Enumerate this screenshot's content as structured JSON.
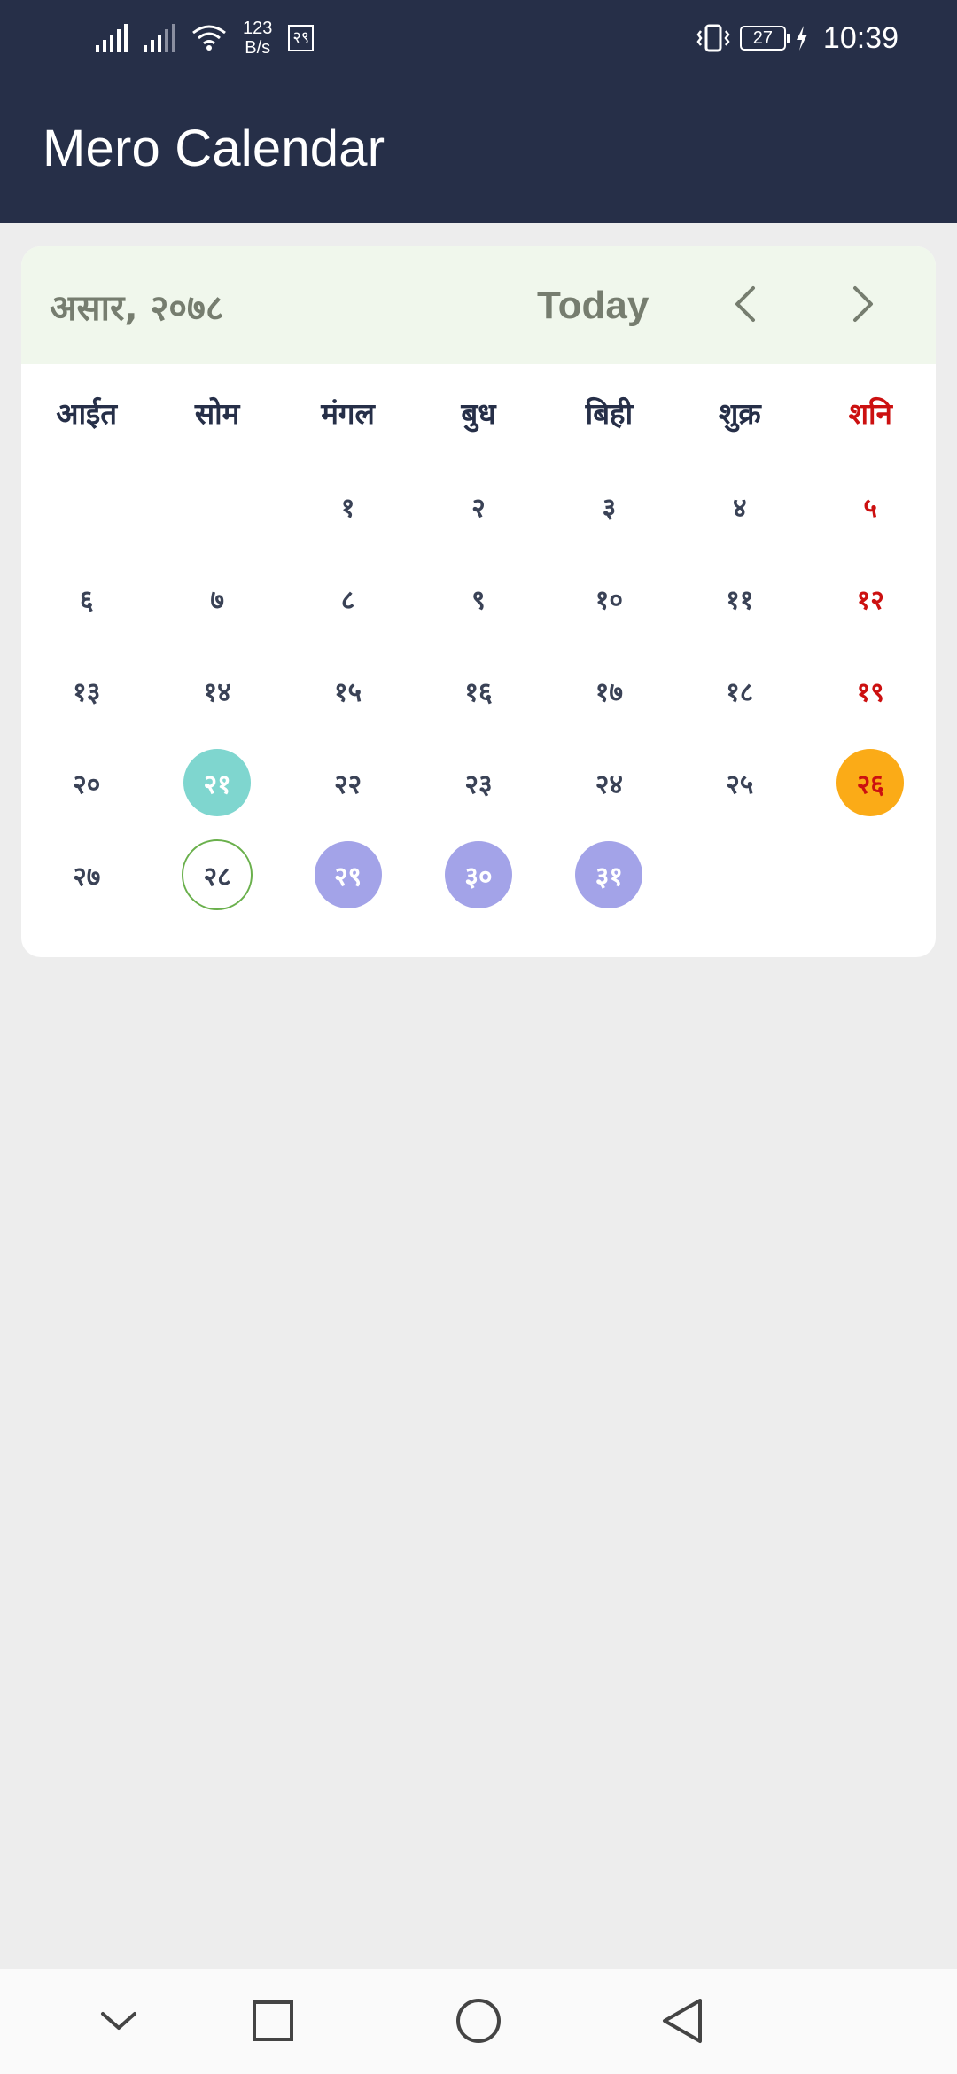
{
  "status_bar": {
    "net_speed_value": "123",
    "net_speed_unit": "B/s",
    "notification_badge": "२९",
    "battery": "27",
    "time": "10:39"
  },
  "app_bar": {
    "title": "Mero Calendar"
  },
  "calendar": {
    "month_label": "असार, २०७८",
    "today_label": "Today",
    "weekdays": [
      "आईत",
      "सोम",
      "मंगल",
      "बुध",
      "बिही",
      "शुक्र",
      "शनि"
    ],
    "weeks": [
      [
        "",
        "",
        "१",
        "२",
        "३",
        "४",
        "५"
      ],
      [
        "६",
        "७",
        "८",
        "९",
        "१०",
        "११",
        "१२"
      ],
      [
        "१३",
        "१४",
        "१५",
        "१६",
        "१७",
        "१८",
        "१९"
      ],
      [
        "२०",
        "२१",
        "२२",
        "२३",
        "२४",
        "२५",
        "२६"
      ],
      [
        "२७",
        "२८",
        "२९",
        "३०",
        "३१",
        "",
        ""
      ]
    ]
  },
  "colors": {
    "header": "#262f48",
    "card_header": "#f0f7ec",
    "saturday": "#cc1010",
    "teal_marker": "#7fd6cf",
    "orange_marker": "#fbab17",
    "today_outline": "#6ab04c",
    "purple_marker": "#a3a3e8",
    "background": "#ededed"
  },
  "icons": {
    "prev": "chevron-left-icon",
    "next": "chevron-right-icon",
    "nav_hide": "chevron-down-icon",
    "nav_recents": "square-icon",
    "nav_home": "circle-icon",
    "nav_back": "triangle-back-icon"
  }
}
